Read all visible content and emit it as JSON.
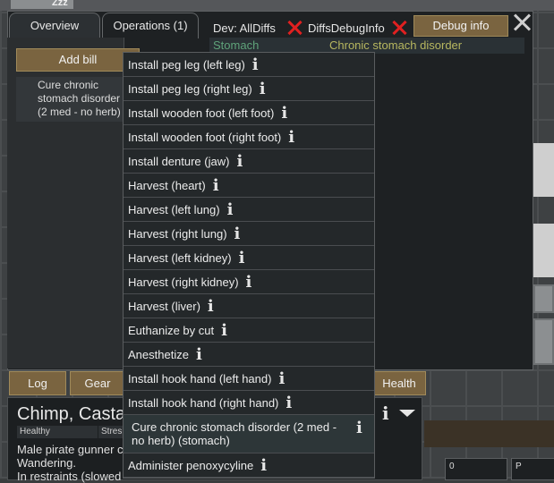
{
  "top_label": "Zzz",
  "tabs": [
    {
      "label": "Overview"
    },
    {
      "label": "Operations (1)"
    }
  ],
  "toolbar": {
    "dev_alldiffs": "Dev: AllDiffs",
    "diffs_debug": "DiffsDebugInfo",
    "debug_info": "Debug info"
  },
  "hediff": {
    "part": "Stomach",
    "name": "Chronic stomach disorder"
  },
  "bills": {
    "add_bill": "Add bill",
    "current": "Cure chronic stomach disorder (2 med - no herb)"
  },
  "menu_items": [
    {
      "label": "Install peg leg (left leg)"
    },
    {
      "label": "Install peg leg (right leg)"
    },
    {
      "label": "Install wooden foot (left foot)"
    },
    {
      "label": "Install wooden foot (right foot)"
    },
    {
      "label": "Install denture (jaw)"
    },
    {
      "label": "Harvest (heart)"
    },
    {
      "label": "Harvest (left lung)"
    },
    {
      "label": "Harvest (right lung)"
    },
    {
      "label": "Harvest (left kidney)"
    },
    {
      "label": "Harvest (right kidney)"
    },
    {
      "label": "Harvest (liver)"
    },
    {
      "label": "Euthanize by cut"
    },
    {
      "label": "Anesthetize"
    },
    {
      "label": "Install hook hand (left hand)"
    },
    {
      "label": "Install hook hand (right hand)"
    },
    {
      "label": "Cure chronic stomach disorder (2 med - no herb) (stomach)"
    },
    {
      "label": "Administer penoxycyline"
    }
  ],
  "info_glyph": "i",
  "bottom_tabs": {
    "log": "Log",
    "gear": "Gear",
    "health": "Health"
  },
  "pawn": {
    "name": "Chimp, Casta",
    "badge1": "Healthy",
    "badge2": "Stres",
    "desc1": "Male pirate gunner c",
    "desc2": "Wandering.",
    "desc3": "In restraints (slowed"
  },
  "widgets": {
    "w1": "0",
    "w2": "P"
  }
}
